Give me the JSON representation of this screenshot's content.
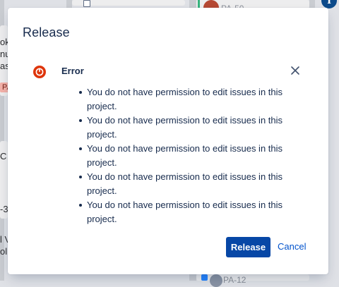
{
  "background": {
    "left_fragments": [
      "ok",
      "nu",
      "as",
      "PA",
      "C",
      "-3",
      "l V",
      "ol"
    ],
    "issue_keys": [
      "PA-50",
      "PA-12"
    ],
    "info_glyph": "i"
  },
  "dialog": {
    "title": "Release",
    "error": {
      "icon": "error-icon",
      "title": "Error",
      "close_icon": "close-icon",
      "messages": [
        "You do not have permission to edit issues in this project.",
        "You do not have permission to edit issues in this project.",
        "You do not have permission to edit issues in this project.",
        "You do not have permission to edit issues in this project.",
        "You do not have permission to edit issues in this project."
      ]
    },
    "buttons": {
      "release_label": "Release",
      "cancel_label": "Cancel"
    }
  },
  "colors": {
    "primary_button": "#0747a6",
    "link": "#0052cc",
    "error_red": "#de350b",
    "text": "#172b4d",
    "overlay": "#dfe1e6"
  }
}
